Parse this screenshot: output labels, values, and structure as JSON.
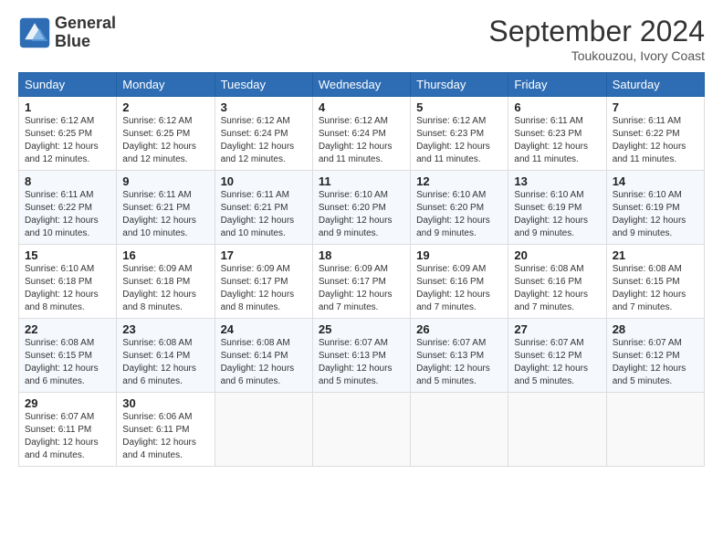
{
  "logo": {
    "line1": "General",
    "line2": "Blue"
  },
  "title": "September 2024",
  "location": "Toukouzou, Ivory Coast",
  "weekdays": [
    "Sunday",
    "Monday",
    "Tuesday",
    "Wednesday",
    "Thursday",
    "Friday",
    "Saturday"
  ],
  "weeks": [
    [
      {
        "day": "1",
        "sunrise": "6:12 AM",
        "sunset": "6:25 PM",
        "daylight": "12 hours and 12 minutes."
      },
      {
        "day": "2",
        "sunrise": "6:12 AM",
        "sunset": "6:25 PM",
        "daylight": "12 hours and 12 minutes."
      },
      {
        "day": "3",
        "sunrise": "6:12 AM",
        "sunset": "6:24 PM",
        "daylight": "12 hours and 12 minutes."
      },
      {
        "day": "4",
        "sunrise": "6:12 AM",
        "sunset": "6:24 PM",
        "daylight": "12 hours and 11 minutes."
      },
      {
        "day": "5",
        "sunrise": "6:12 AM",
        "sunset": "6:23 PM",
        "daylight": "12 hours and 11 minutes."
      },
      {
        "day": "6",
        "sunrise": "6:11 AM",
        "sunset": "6:23 PM",
        "daylight": "12 hours and 11 minutes."
      },
      {
        "day": "7",
        "sunrise": "6:11 AM",
        "sunset": "6:22 PM",
        "daylight": "12 hours and 11 minutes."
      }
    ],
    [
      {
        "day": "8",
        "sunrise": "6:11 AM",
        "sunset": "6:22 PM",
        "daylight": "12 hours and 10 minutes."
      },
      {
        "day": "9",
        "sunrise": "6:11 AM",
        "sunset": "6:21 PM",
        "daylight": "12 hours and 10 minutes."
      },
      {
        "day": "10",
        "sunrise": "6:11 AM",
        "sunset": "6:21 PM",
        "daylight": "12 hours and 10 minutes."
      },
      {
        "day": "11",
        "sunrise": "6:10 AM",
        "sunset": "6:20 PM",
        "daylight": "12 hours and 9 minutes."
      },
      {
        "day": "12",
        "sunrise": "6:10 AM",
        "sunset": "6:20 PM",
        "daylight": "12 hours and 9 minutes."
      },
      {
        "day": "13",
        "sunrise": "6:10 AM",
        "sunset": "6:19 PM",
        "daylight": "12 hours and 9 minutes."
      },
      {
        "day": "14",
        "sunrise": "6:10 AM",
        "sunset": "6:19 PM",
        "daylight": "12 hours and 9 minutes."
      }
    ],
    [
      {
        "day": "15",
        "sunrise": "6:10 AM",
        "sunset": "6:18 PM",
        "daylight": "12 hours and 8 minutes."
      },
      {
        "day": "16",
        "sunrise": "6:09 AM",
        "sunset": "6:18 PM",
        "daylight": "12 hours and 8 minutes."
      },
      {
        "day": "17",
        "sunrise": "6:09 AM",
        "sunset": "6:17 PM",
        "daylight": "12 hours and 8 minutes."
      },
      {
        "day": "18",
        "sunrise": "6:09 AM",
        "sunset": "6:17 PM",
        "daylight": "12 hours and 7 minutes."
      },
      {
        "day": "19",
        "sunrise": "6:09 AM",
        "sunset": "6:16 PM",
        "daylight": "12 hours and 7 minutes."
      },
      {
        "day": "20",
        "sunrise": "6:08 AM",
        "sunset": "6:16 PM",
        "daylight": "12 hours and 7 minutes."
      },
      {
        "day": "21",
        "sunrise": "6:08 AM",
        "sunset": "6:15 PM",
        "daylight": "12 hours and 7 minutes."
      }
    ],
    [
      {
        "day": "22",
        "sunrise": "6:08 AM",
        "sunset": "6:15 PM",
        "daylight": "12 hours and 6 minutes."
      },
      {
        "day": "23",
        "sunrise": "6:08 AM",
        "sunset": "6:14 PM",
        "daylight": "12 hours and 6 minutes."
      },
      {
        "day": "24",
        "sunrise": "6:08 AM",
        "sunset": "6:14 PM",
        "daylight": "12 hours and 6 minutes."
      },
      {
        "day": "25",
        "sunrise": "6:07 AM",
        "sunset": "6:13 PM",
        "daylight": "12 hours and 5 minutes."
      },
      {
        "day": "26",
        "sunrise": "6:07 AM",
        "sunset": "6:13 PM",
        "daylight": "12 hours and 5 minutes."
      },
      {
        "day": "27",
        "sunrise": "6:07 AM",
        "sunset": "6:12 PM",
        "daylight": "12 hours and 5 minutes."
      },
      {
        "day": "28",
        "sunrise": "6:07 AM",
        "sunset": "6:12 PM",
        "daylight": "12 hours and 5 minutes."
      }
    ],
    [
      {
        "day": "29",
        "sunrise": "6:07 AM",
        "sunset": "6:11 PM",
        "daylight": "12 hours and 4 minutes."
      },
      {
        "day": "30",
        "sunrise": "6:06 AM",
        "sunset": "6:11 PM",
        "daylight": "12 hours and 4 minutes."
      },
      null,
      null,
      null,
      null,
      null
    ]
  ]
}
